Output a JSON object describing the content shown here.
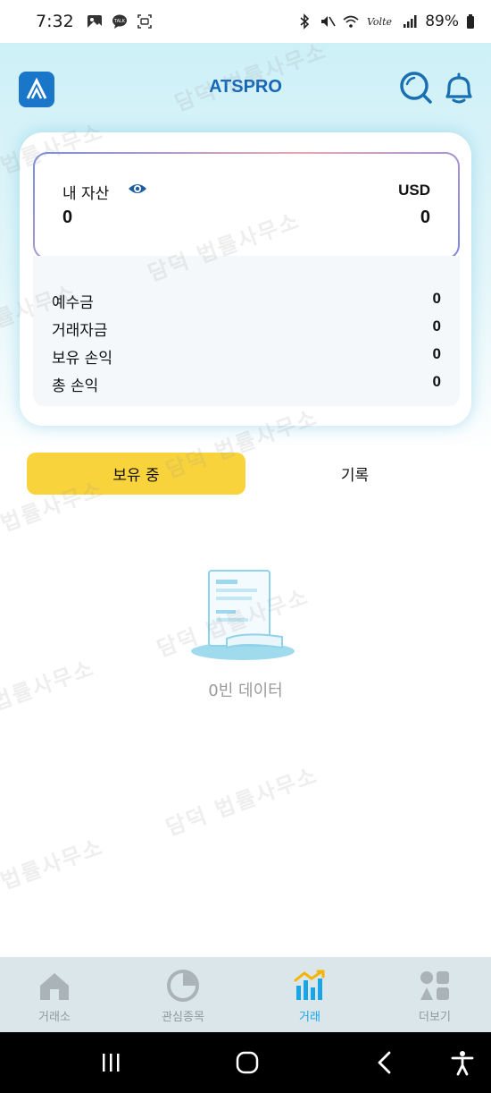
{
  "status_bar": {
    "time": "7:32",
    "battery": "89%"
  },
  "app": {
    "title": "ATSPRO"
  },
  "assets": {
    "label": "내 자산",
    "currency": "USD",
    "value_left": "0",
    "value_right": "0",
    "rows": [
      {
        "label": "예수금",
        "value": "0"
      },
      {
        "label": "거래자금",
        "value": "0"
      },
      {
        "label": "보유 손익",
        "value": "0"
      },
      {
        "label": "총 손익",
        "value": "0"
      }
    ]
  },
  "tabs": {
    "holding": "보유 중",
    "history": "기록"
  },
  "empty_state": {
    "text": "0빈 데이터"
  },
  "watermark": {
    "text": "담덕 법률사무소"
  },
  "bottom_nav": [
    {
      "label": "거래소",
      "icon": "exchange-icon",
      "active": false
    },
    {
      "label": "관심종목",
      "icon": "watchlist-icon",
      "active": false
    },
    {
      "label": "거래",
      "icon": "trade-chart-icon",
      "active": true
    },
    {
      "label": "더보기",
      "icon": "more-grid-icon",
      "active": false
    }
  ],
  "colors": {
    "brand_blue": "#1565b8",
    "active_tab": "#f9d33b",
    "nav_active": "#1aa6e6"
  }
}
